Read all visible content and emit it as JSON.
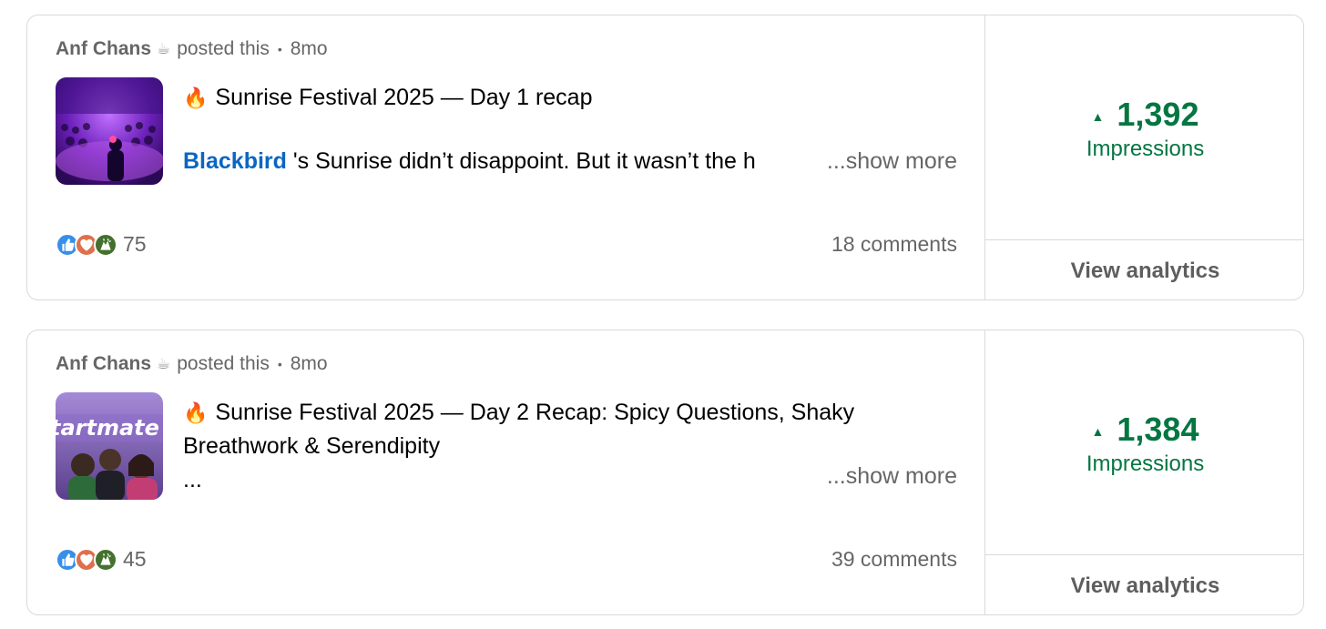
{
  "posts": [
    {
      "author": "Anf Chans",
      "author_emoji": "☕",
      "action": "posted this",
      "separator": "•",
      "age": "8mo",
      "title_emoji": "🔥",
      "title": "Sunrise Festival 2025 — Day 1 recap",
      "mention": "Blackbird",
      "body": " 's Sunrise didn’t disappoint. But it wasn’t the h",
      "show_more": "...show more",
      "reaction_count": "75",
      "comments": "18 comments",
      "impressions": "1,392",
      "impressions_label": "Impressions",
      "trend": "▲",
      "analytics_label": "View analytics"
    },
    {
      "author": "Anf Chans",
      "author_emoji": "☕",
      "action": "posted this",
      "separator": "•",
      "age": "8mo",
      "title_emoji": "🔥",
      "title": "Sunrise Festival 2025 — Day 2 Recap: Spicy Questions, Shaky Breathwork & Serendipity",
      "body": "...",
      "show_more": "...show more",
      "thumb_text": "tartmate",
      "reaction_count": "45",
      "comments": "39 comments",
      "impressions": "1,384",
      "impressions_label": "Impressions",
      "trend": "▲",
      "analytics_label": "View analytics"
    }
  ],
  "colors": {
    "accent_green": "#057642",
    "mention_blue": "#0a66c2",
    "muted_text": "#666666",
    "border": "#d9d9d9"
  }
}
